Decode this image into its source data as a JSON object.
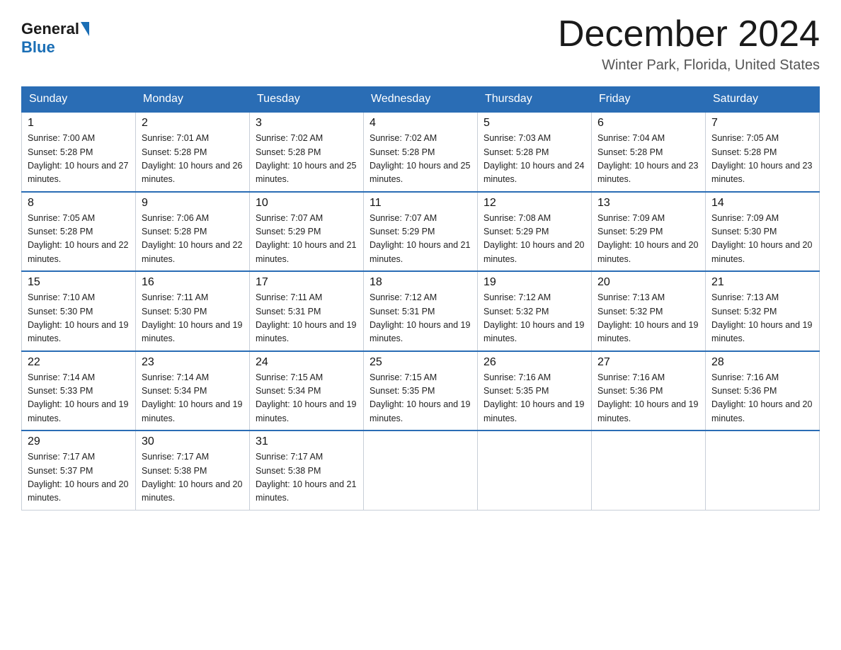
{
  "logo": {
    "general": "General",
    "blue": "Blue"
  },
  "header": {
    "month": "December 2024",
    "location": "Winter Park, Florida, United States"
  },
  "days_of_week": [
    "Sunday",
    "Monday",
    "Tuesday",
    "Wednesday",
    "Thursday",
    "Friday",
    "Saturday"
  ],
  "weeks": [
    [
      {
        "day": "1",
        "sunrise": "7:00 AM",
        "sunset": "5:28 PM",
        "daylight": "10 hours and 27 minutes."
      },
      {
        "day": "2",
        "sunrise": "7:01 AM",
        "sunset": "5:28 PM",
        "daylight": "10 hours and 26 minutes."
      },
      {
        "day": "3",
        "sunrise": "7:02 AM",
        "sunset": "5:28 PM",
        "daylight": "10 hours and 25 minutes."
      },
      {
        "day": "4",
        "sunrise": "7:02 AM",
        "sunset": "5:28 PM",
        "daylight": "10 hours and 25 minutes."
      },
      {
        "day": "5",
        "sunrise": "7:03 AM",
        "sunset": "5:28 PM",
        "daylight": "10 hours and 24 minutes."
      },
      {
        "day": "6",
        "sunrise": "7:04 AM",
        "sunset": "5:28 PM",
        "daylight": "10 hours and 23 minutes."
      },
      {
        "day": "7",
        "sunrise": "7:05 AM",
        "sunset": "5:28 PM",
        "daylight": "10 hours and 23 minutes."
      }
    ],
    [
      {
        "day": "8",
        "sunrise": "7:05 AM",
        "sunset": "5:28 PM",
        "daylight": "10 hours and 22 minutes."
      },
      {
        "day": "9",
        "sunrise": "7:06 AM",
        "sunset": "5:28 PM",
        "daylight": "10 hours and 22 minutes."
      },
      {
        "day": "10",
        "sunrise": "7:07 AM",
        "sunset": "5:29 PM",
        "daylight": "10 hours and 21 minutes."
      },
      {
        "day": "11",
        "sunrise": "7:07 AM",
        "sunset": "5:29 PM",
        "daylight": "10 hours and 21 minutes."
      },
      {
        "day": "12",
        "sunrise": "7:08 AM",
        "sunset": "5:29 PM",
        "daylight": "10 hours and 20 minutes."
      },
      {
        "day": "13",
        "sunrise": "7:09 AM",
        "sunset": "5:29 PM",
        "daylight": "10 hours and 20 minutes."
      },
      {
        "day": "14",
        "sunrise": "7:09 AM",
        "sunset": "5:30 PM",
        "daylight": "10 hours and 20 minutes."
      }
    ],
    [
      {
        "day": "15",
        "sunrise": "7:10 AM",
        "sunset": "5:30 PM",
        "daylight": "10 hours and 19 minutes."
      },
      {
        "day": "16",
        "sunrise": "7:11 AM",
        "sunset": "5:30 PM",
        "daylight": "10 hours and 19 minutes."
      },
      {
        "day": "17",
        "sunrise": "7:11 AM",
        "sunset": "5:31 PM",
        "daylight": "10 hours and 19 minutes."
      },
      {
        "day": "18",
        "sunrise": "7:12 AM",
        "sunset": "5:31 PM",
        "daylight": "10 hours and 19 minutes."
      },
      {
        "day": "19",
        "sunrise": "7:12 AM",
        "sunset": "5:32 PM",
        "daylight": "10 hours and 19 minutes."
      },
      {
        "day": "20",
        "sunrise": "7:13 AM",
        "sunset": "5:32 PM",
        "daylight": "10 hours and 19 minutes."
      },
      {
        "day": "21",
        "sunrise": "7:13 AM",
        "sunset": "5:32 PM",
        "daylight": "10 hours and 19 minutes."
      }
    ],
    [
      {
        "day": "22",
        "sunrise": "7:14 AM",
        "sunset": "5:33 PM",
        "daylight": "10 hours and 19 minutes."
      },
      {
        "day": "23",
        "sunrise": "7:14 AM",
        "sunset": "5:34 PM",
        "daylight": "10 hours and 19 minutes."
      },
      {
        "day": "24",
        "sunrise": "7:15 AM",
        "sunset": "5:34 PM",
        "daylight": "10 hours and 19 minutes."
      },
      {
        "day": "25",
        "sunrise": "7:15 AM",
        "sunset": "5:35 PM",
        "daylight": "10 hours and 19 minutes."
      },
      {
        "day": "26",
        "sunrise": "7:16 AM",
        "sunset": "5:35 PM",
        "daylight": "10 hours and 19 minutes."
      },
      {
        "day": "27",
        "sunrise": "7:16 AM",
        "sunset": "5:36 PM",
        "daylight": "10 hours and 19 minutes."
      },
      {
        "day": "28",
        "sunrise": "7:16 AM",
        "sunset": "5:36 PM",
        "daylight": "10 hours and 20 minutes."
      }
    ],
    [
      {
        "day": "29",
        "sunrise": "7:17 AM",
        "sunset": "5:37 PM",
        "daylight": "10 hours and 20 minutes."
      },
      {
        "day": "30",
        "sunrise": "7:17 AM",
        "sunset": "5:38 PM",
        "daylight": "10 hours and 20 minutes."
      },
      {
        "day": "31",
        "sunrise": "7:17 AM",
        "sunset": "5:38 PM",
        "daylight": "10 hours and 21 minutes."
      },
      null,
      null,
      null,
      null
    ]
  ]
}
